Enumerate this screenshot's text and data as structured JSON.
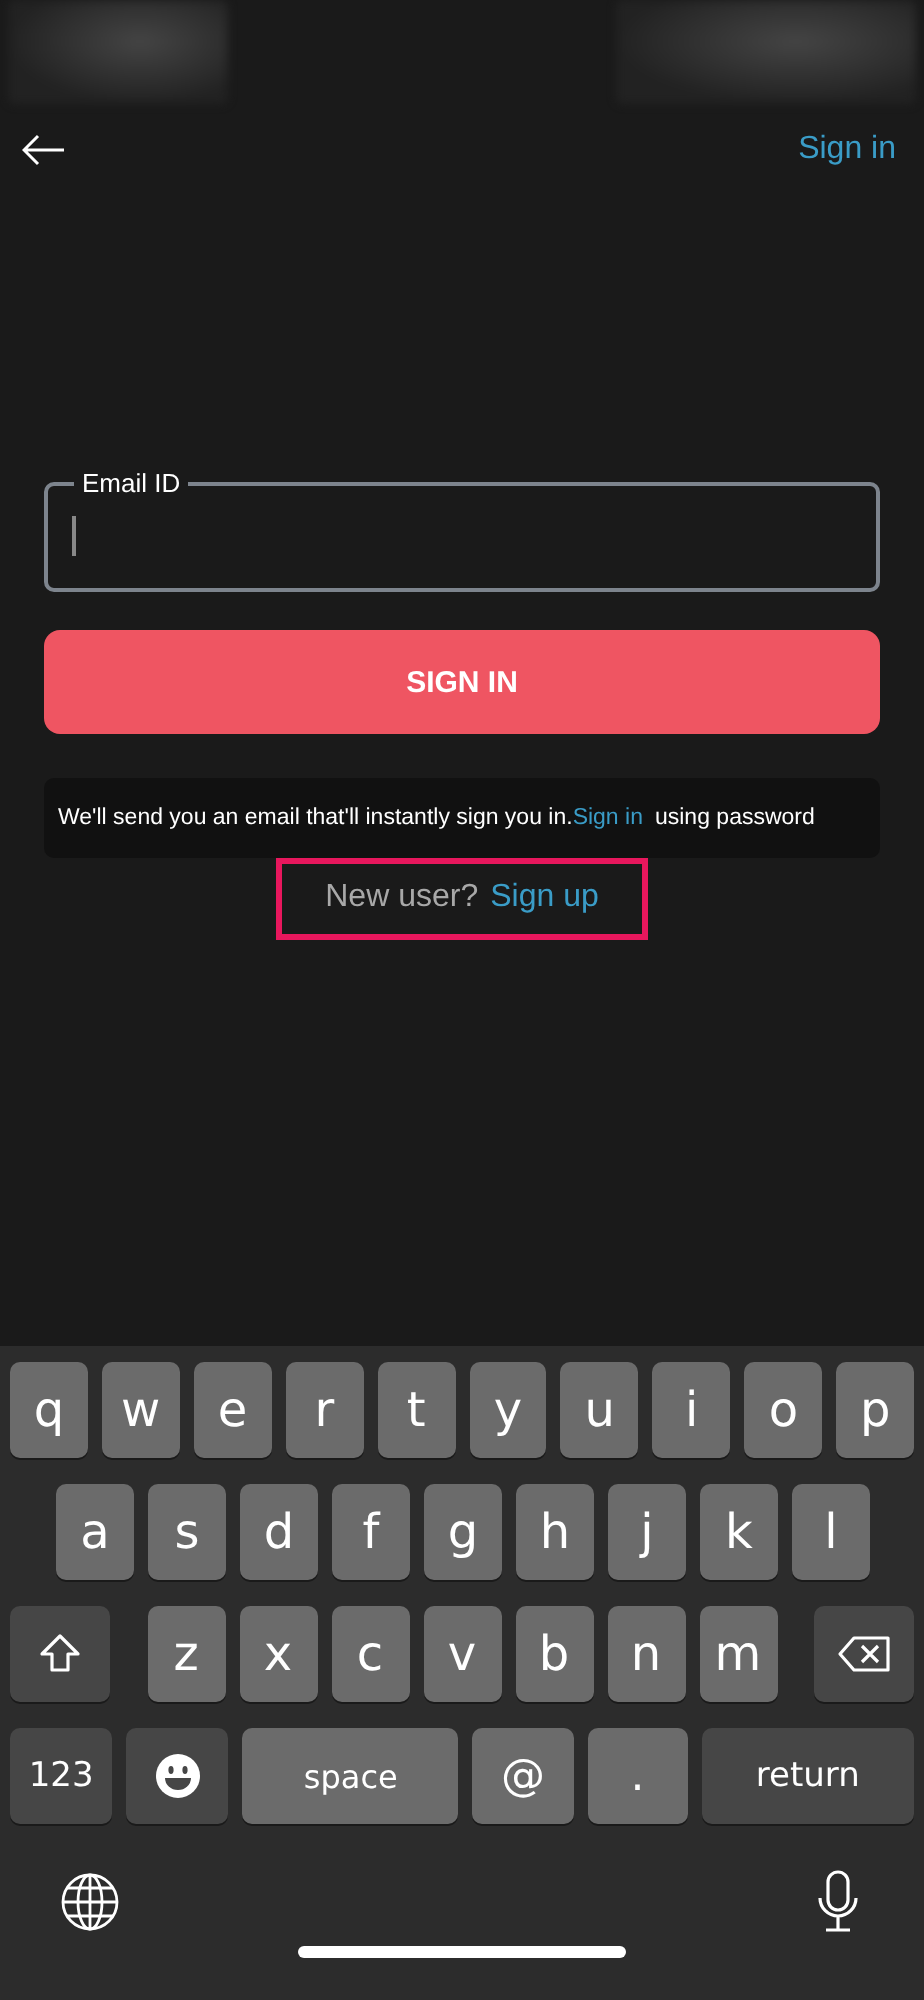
{
  "nav": {
    "action": "Sign in"
  },
  "email_field": {
    "label": "Email ID",
    "focused": true
  },
  "submit_button": "SIGN IN",
  "info": {
    "before": "We'll send you an email that'll instantly sign you in.",
    "link": "Sign in",
    "after": "using password"
  },
  "signup_prompt": {
    "text": "New user?",
    "link": "Sign up",
    "highlighted": true
  },
  "keyboard": {
    "key_groups": [
      [
        {
          "kind": "letter",
          "label": "q"
        },
        {
          "kind": "letter",
          "label": "w"
        },
        {
          "kind": "letter",
          "label": "e"
        },
        {
          "kind": "letter",
          "label": "r"
        },
        {
          "kind": "letter",
          "label": "t"
        },
        {
          "kind": "letter",
          "label": "y"
        },
        {
          "kind": "letter",
          "label": "u"
        },
        {
          "kind": "letter",
          "label": "i"
        },
        {
          "kind": "letter",
          "label": "o"
        },
        {
          "kind": "letter",
          "label": "p"
        }
      ],
      [
        {
          "kind": "letter",
          "label": "a"
        },
        {
          "kind": "letter",
          "label": "s"
        },
        {
          "kind": "letter",
          "label": "d"
        },
        {
          "kind": "letter",
          "label": "f"
        },
        {
          "kind": "letter",
          "label": "g"
        },
        {
          "kind": "letter",
          "label": "h"
        },
        {
          "kind": "letter",
          "label": "j"
        },
        {
          "kind": "letter",
          "label": "k"
        },
        {
          "kind": "letter",
          "label": "l"
        }
      ],
      [
        {
          "kind": "shift"
        },
        {
          "kind": "letter",
          "label": "z"
        },
        {
          "kind": "letter",
          "label": "x"
        },
        {
          "kind": "letter",
          "label": "c"
        },
        {
          "kind": "letter",
          "label": "v"
        },
        {
          "kind": "letter",
          "label": "b"
        },
        {
          "kind": "letter",
          "label": "n"
        },
        {
          "kind": "letter",
          "label": "m"
        },
        {
          "kind": "delete"
        }
      ],
      [
        {
          "kind": "numbers",
          "label": "123"
        },
        {
          "kind": "emoji"
        },
        {
          "kind": "space",
          "label": "space"
        },
        {
          "kind": "symbol",
          "label": "@"
        },
        {
          "kind": "symbol",
          "label": "."
        },
        {
          "kind": "return",
          "label": "return"
        }
      ]
    ]
  }
}
